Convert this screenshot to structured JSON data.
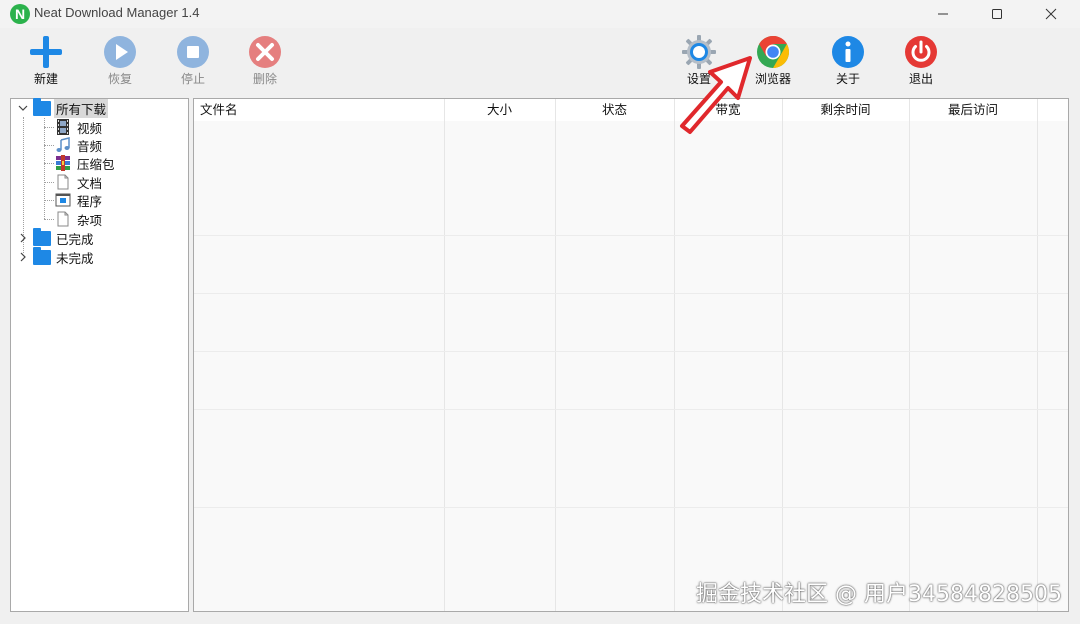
{
  "window": {
    "logo_letter": "N",
    "title": "Neat Download Manager 1.4"
  },
  "toolbar": {
    "new_label": "新建",
    "resume_label": "恢复",
    "stop_label": "停止",
    "delete_label": "删除",
    "settings_label": "设置",
    "browser_label": "浏览器",
    "about_label": "关于",
    "exit_label": "退出"
  },
  "tree": {
    "all_downloads": "所有下载",
    "video": "视频",
    "audio": "音频",
    "archive": "压缩包",
    "document": "文档",
    "program": "程序",
    "misc": "杂项",
    "completed": "已完成",
    "incomplete": "未完成"
  },
  "list": {
    "columns": [
      "文件名",
      "大小",
      "状态",
      "带宽",
      "剩余时间",
      "最后访问"
    ]
  },
  "watermark": "掘金技术社区 @ 用户34584828505",
  "colors": {
    "accent_blue": "#1e88e5",
    "exit_red": "#e53935",
    "logo_green": "#2bb24c",
    "arrow_red": "#e0282c"
  }
}
